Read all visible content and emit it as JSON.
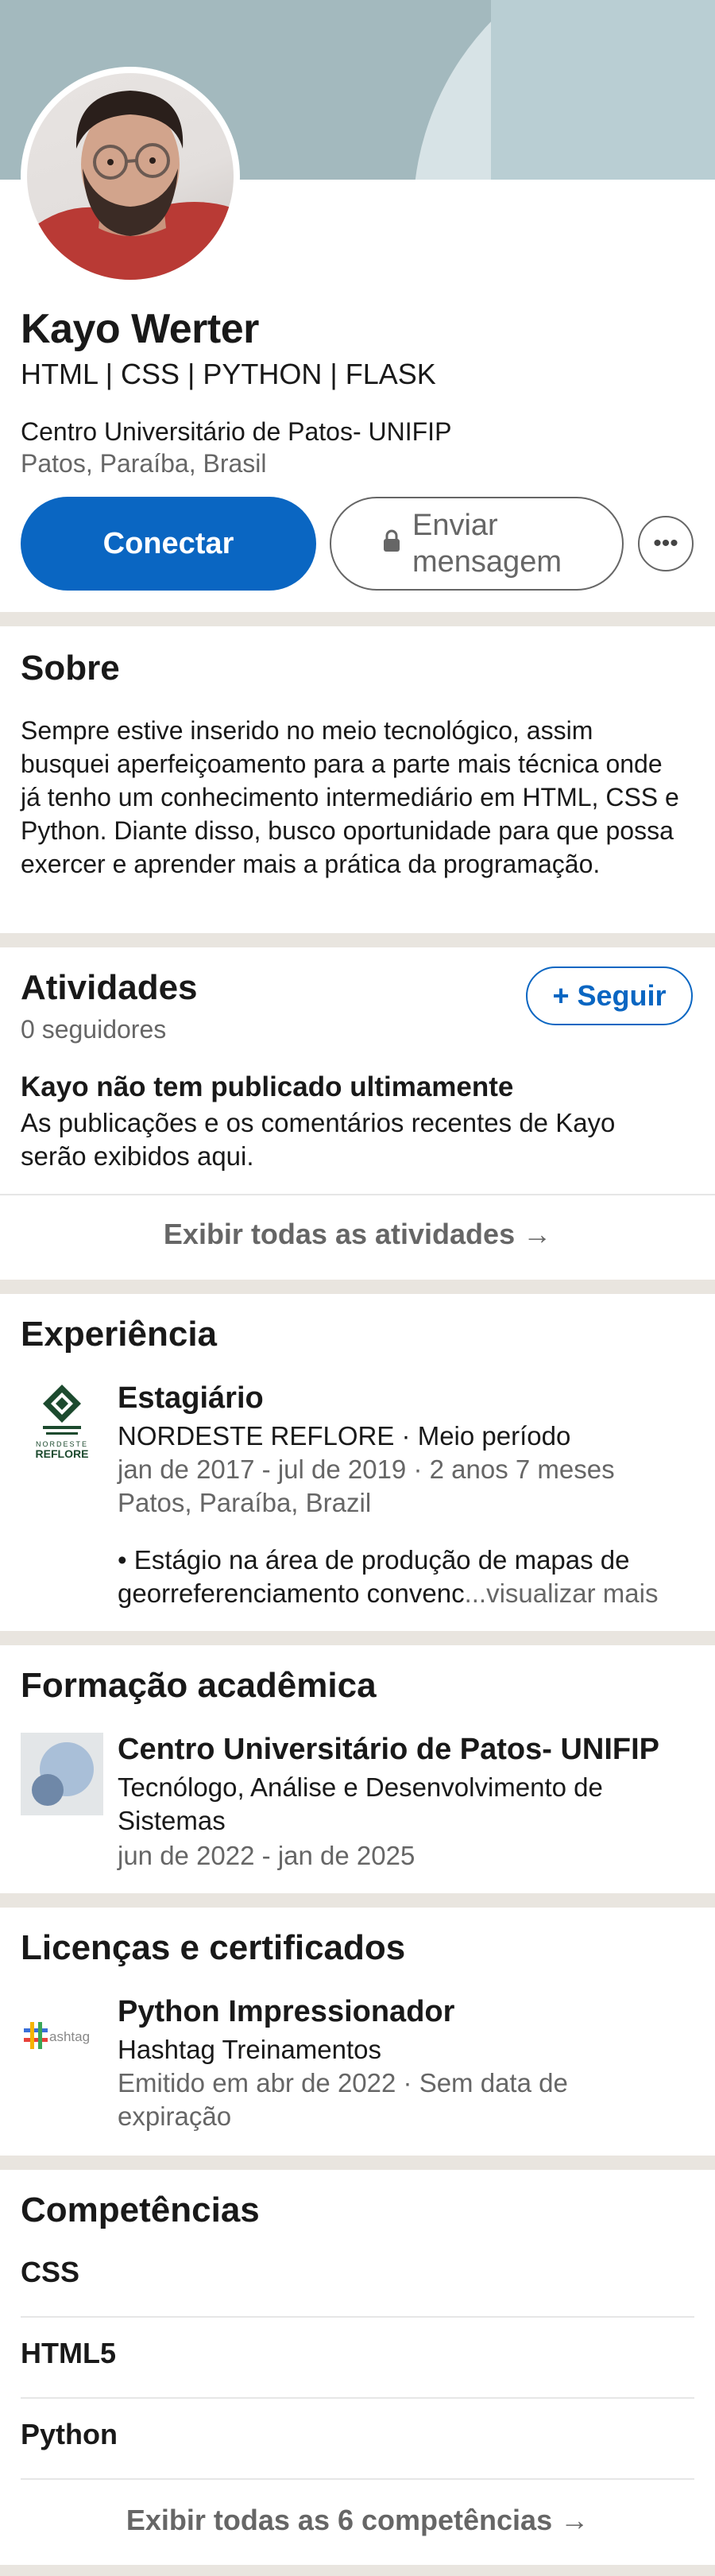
{
  "profile": {
    "name": "Kayo Werter",
    "headline": "HTML | CSS | PYTHON | FLASK",
    "education": "Centro Universitário de Patos- UNIFIP",
    "location": "Patos, Paraíba, Brasil"
  },
  "actions": {
    "connect_label": "Conectar",
    "message_label": "Enviar mensagem",
    "more_icon": "ellipsis-icon",
    "lock_icon": "lock-icon"
  },
  "about": {
    "title": "Sobre",
    "text": "Sempre estive inserido no meio tecnológico, assim busquei aperfeiçoamento para a parte mais técnica onde já tenho um conhecimento intermediário em HTML, CSS e Python. Diante disso, busco oportunidade para que possa exercer e aprender mais a prática da programação."
  },
  "activity": {
    "title": "Atividades",
    "followers": "0 seguidores",
    "follow_label": "+ Seguir",
    "empty_title": "Kayo não tem publicado ultimamente",
    "empty_text": "As publicações e os comentários recentes de Kayo serão exibidos aqui.",
    "show_all": "Exibir todas as atividades →"
  },
  "experience": {
    "title": "Experiência",
    "items": [
      {
        "role": "Estagiário",
        "company": "NORDESTE REFLORE · Meio período",
        "dates": "jan de 2017 - jul de 2019 · 2 anos 7 meses",
        "location": "Patos, Paraíba, Brazil",
        "description": "• Estágio na área de produção de mapas de georreferenciamento convenc",
        "more": "...visualizar mais",
        "logo_text": "NORDESTE\nREFLORE"
      }
    ]
  },
  "education": {
    "title": "Formação acadêmica",
    "items": [
      {
        "school": "Centro Universitário de Patos- UNIFIP",
        "degree": "Tecnólogo, Análise e Desenvolvimento de Sistemas",
        "dates": "jun de 2022 - jan de 2025"
      }
    ]
  },
  "certifications": {
    "title": "Licenças e certificados",
    "items": [
      {
        "name": "Python Impressionador",
        "issuer": "Hashtag Treinamentos",
        "issued": "Emitido em abr de 2022 · Sem data de expiração",
        "logo_text": "hashtag"
      }
    ]
  },
  "skills": {
    "title": "Competências",
    "items": [
      "CSS",
      "HTML5",
      "Python"
    ],
    "show_all": "Exibir todas as 6 competências →"
  },
  "colors": {
    "primary": "#0a66c2",
    "divider": "#e9e5df",
    "muted": "#666666"
  }
}
